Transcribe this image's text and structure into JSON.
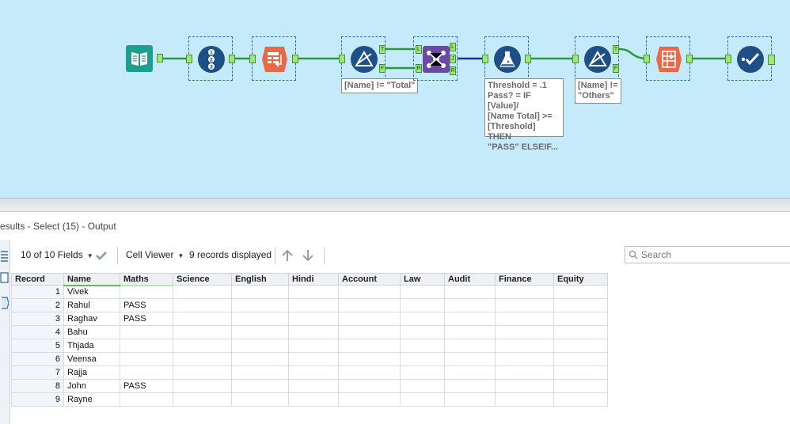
{
  "canvas": {
    "tools": [
      {
        "id": "input",
        "icon": "book-input-icon"
      },
      {
        "id": "record-id",
        "icon": "record-id-icon"
      },
      {
        "id": "transpose",
        "icon": "transpose-icon"
      },
      {
        "id": "filter-1",
        "icon": "filter-icon",
        "anchors": [
          "T",
          "F"
        ]
      },
      {
        "id": "join",
        "icon": "join-icon",
        "anchors_in": [
          "L",
          "R"
        ],
        "anchors_out": [
          "L",
          "J",
          "R"
        ]
      },
      {
        "id": "formula",
        "icon": "formula-flask-icon"
      },
      {
        "id": "filter-2",
        "icon": "filter-icon",
        "anchors": [
          "T",
          "F"
        ]
      },
      {
        "id": "cross-tab",
        "icon": "cross-tab-icon"
      },
      {
        "id": "select",
        "icon": "select-check-icon"
      }
    ],
    "annotations": {
      "filter1": "[Name] != \"Total\"",
      "formula": "Threshold = .1\nPass? = IF [Value]/\n[Name Total] >=\n[Threshold] THEN\n\"PASS\" ELSEIF...",
      "filter2": "[Name] !=\n\"Others\""
    },
    "colors": {
      "background": "#c5eafa",
      "wire": "#2a9a3a",
      "join_wire": "#1f2bb0",
      "anchor": "#9ee87a"
    }
  },
  "results": {
    "title": "esults - Select (15) - Output",
    "fields_label": "10 of 10 Fields",
    "viewer_label": "Cell Viewer",
    "records_label": "9 records displayed",
    "search_placeholder": "Search"
  },
  "grid": {
    "columns": [
      "Record",
      "Name",
      "Maths",
      "Science",
      "English",
      "Hindi",
      "Account",
      "Law",
      "Audit",
      "Finance",
      "Equity"
    ],
    "rows": [
      [
        "1",
        "Vivek",
        "",
        "",
        "",
        "",
        "",
        "",
        "",
        "",
        ""
      ],
      [
        "2",
        "Rahul",
        "PASS",
        "",
        "",
        "",
        "",
        "",
        "",
        "",
        ""
      ],
      [
        "3",
        "Raghav",
        "PASS",
        "",
        "",
        "",
        "",
        "",
        "",
        "",
        ""
      ],
      [
        "4",
        "Bahu",
        "",
        "",
        "",
        "",
        "",
        "",
        "",
        "",
        ""
      ],
      [
        "5",
        "Thjada",
        "",
        "",
        "",
        "",
        "",
        "",
        "",
        "",
        ""
      ],
      [
        "6",
        "Veensa",
        "",
        "",
        "",
        "",
        "",
        "",
        "",
        "",
        ""
      ],
      [
        "7",
        "Rajja",
        "",
        "",
        "",
        "",
        "",
        "",
        "",
        "",
        ""
      ],
      [
        "8",
        "John",
        "PASS",
        "",
        "",
        "",
        "",
        "",
        "",
        "",
        ""
      ],
      [
        "9",
        "Rayne",
        "",
        "",
        "",
        "",
        "",
        "",
        "",
        "",
        ""
      ]
    ]
  }
}
